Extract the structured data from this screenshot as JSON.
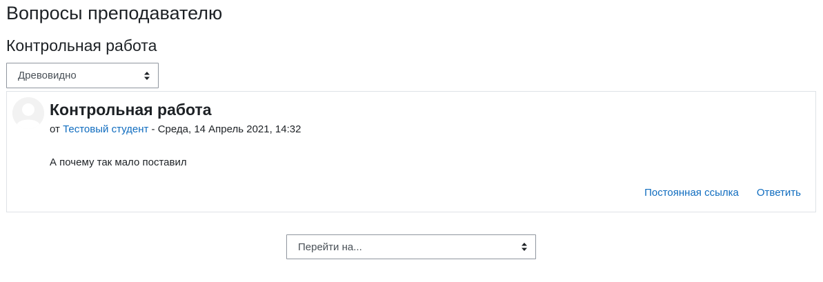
{
  "page": {
    "title": "Вопросы преподавателю"
  },
  "discussion": {
    "title": "Контрольная работа",
    "display_mode": {
      "selected": "Древовидно",
      "icon": "sort-arrows-icon"
    }
  },
  "post": {
    "avatar_icon": "user-avatar-icon",
    "subject": "Контрольная работа",
    "byline_prefix": "от",
    "author": "Тестовый студент",
    "byline_separator": "-",
    "date": "Среда, 14 Апрель 2021, 14:32",
    "body": "А почему так мало поставил",
    "actions": {
      "permalink": "Постоянная ссылка",
      "reply": "Ответить"
    }
  },
  "jump_to": {
    "selected": "Перейти на...",
    "icon": "sort-arrows-icon"
  },
  "colors": {
    "link": "#0f6cbf",
    "text": "#1d2125",
    "border": "#dee2e6",
    "select_border": "#8f959e"
  }
}
